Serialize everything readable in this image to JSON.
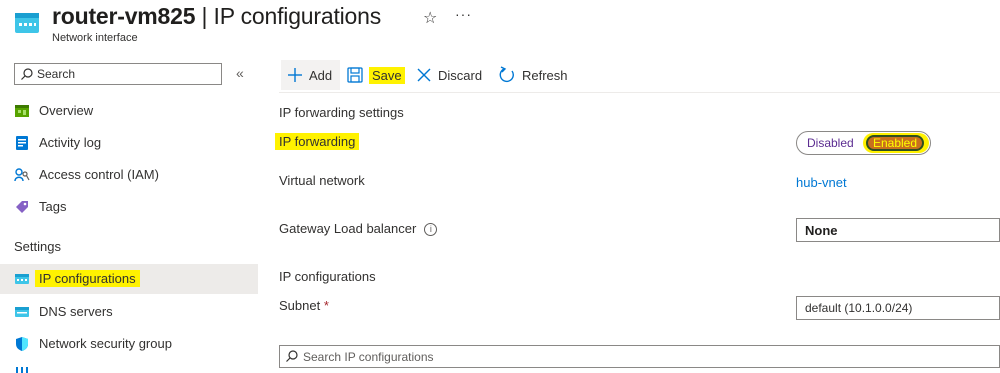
{
  "header": {
    "resource_name": "router-vm825",
    "page_name": "IP configurations",
    "separator": "|",
    "subtitle": "Network interface",
    "favorite_icon": "star-icon",
    "more_icon": "more-icon"
  },
  "sidebar": {
    "search_placeholder": "Search",
    "collapse_glyph": "«",
    "items": [
      {
        "label": "Overview",
        "icon": "overview-icon"
      },
      {
        "label": "Activity log",
        "icon": "activity-log-icon"
      },
      {
        "label": "Access control (IAM)",
        "icon": "iam-icon"
      },
      {
        "label": "Tags",
        "icon": "tag-icon"
      }
    ],
    "settings_heading": "Settings",
    "settings_items": [
      {
        "label": "IP configurations",
        "icon": "ip-config-icon",
        "selected": true
      },
      {
        "label": "DNS servers",
        "icon": "dns-icon"
      },
      {
        "label": "Network security group",
        "icon": "nsg-icon"
      }
    ]
  },
  "toolbar": {
    "add_label": "Add",
    "save_label": "Save",
    "discard_label": "Discard",
    "refresh_label": "Refresh"
  },
  "form": {
    "forwarding_section": "IP forwarding settings",
    "ip_forwarding_label": "IP forwarding",
    "toggle_off": "Disabled",
    "toggle_on": "Enabled",
    "toggle_value": "Enabled",
    "virtual_network_label": "Virtual network",
    "virtual_network_value": "hub-vnet",
    "gateway_lb_label": "Gateway Load balancer",
    "gateway_lb_value": "None",
    "ip_config_section": "IP configurations",
    "subnet_label": "Subnet",
    "subnet_required": "*",
    "subnet_value": "default (10.1.0.0/24)",
    "search_ip_placeholder": "Search IP configurations"
  },
  "colors": {
    "highlight": "#fff200",
    "link": "#0078d4",
    "toggle_on_fill": "#c8701e"
  }
}
